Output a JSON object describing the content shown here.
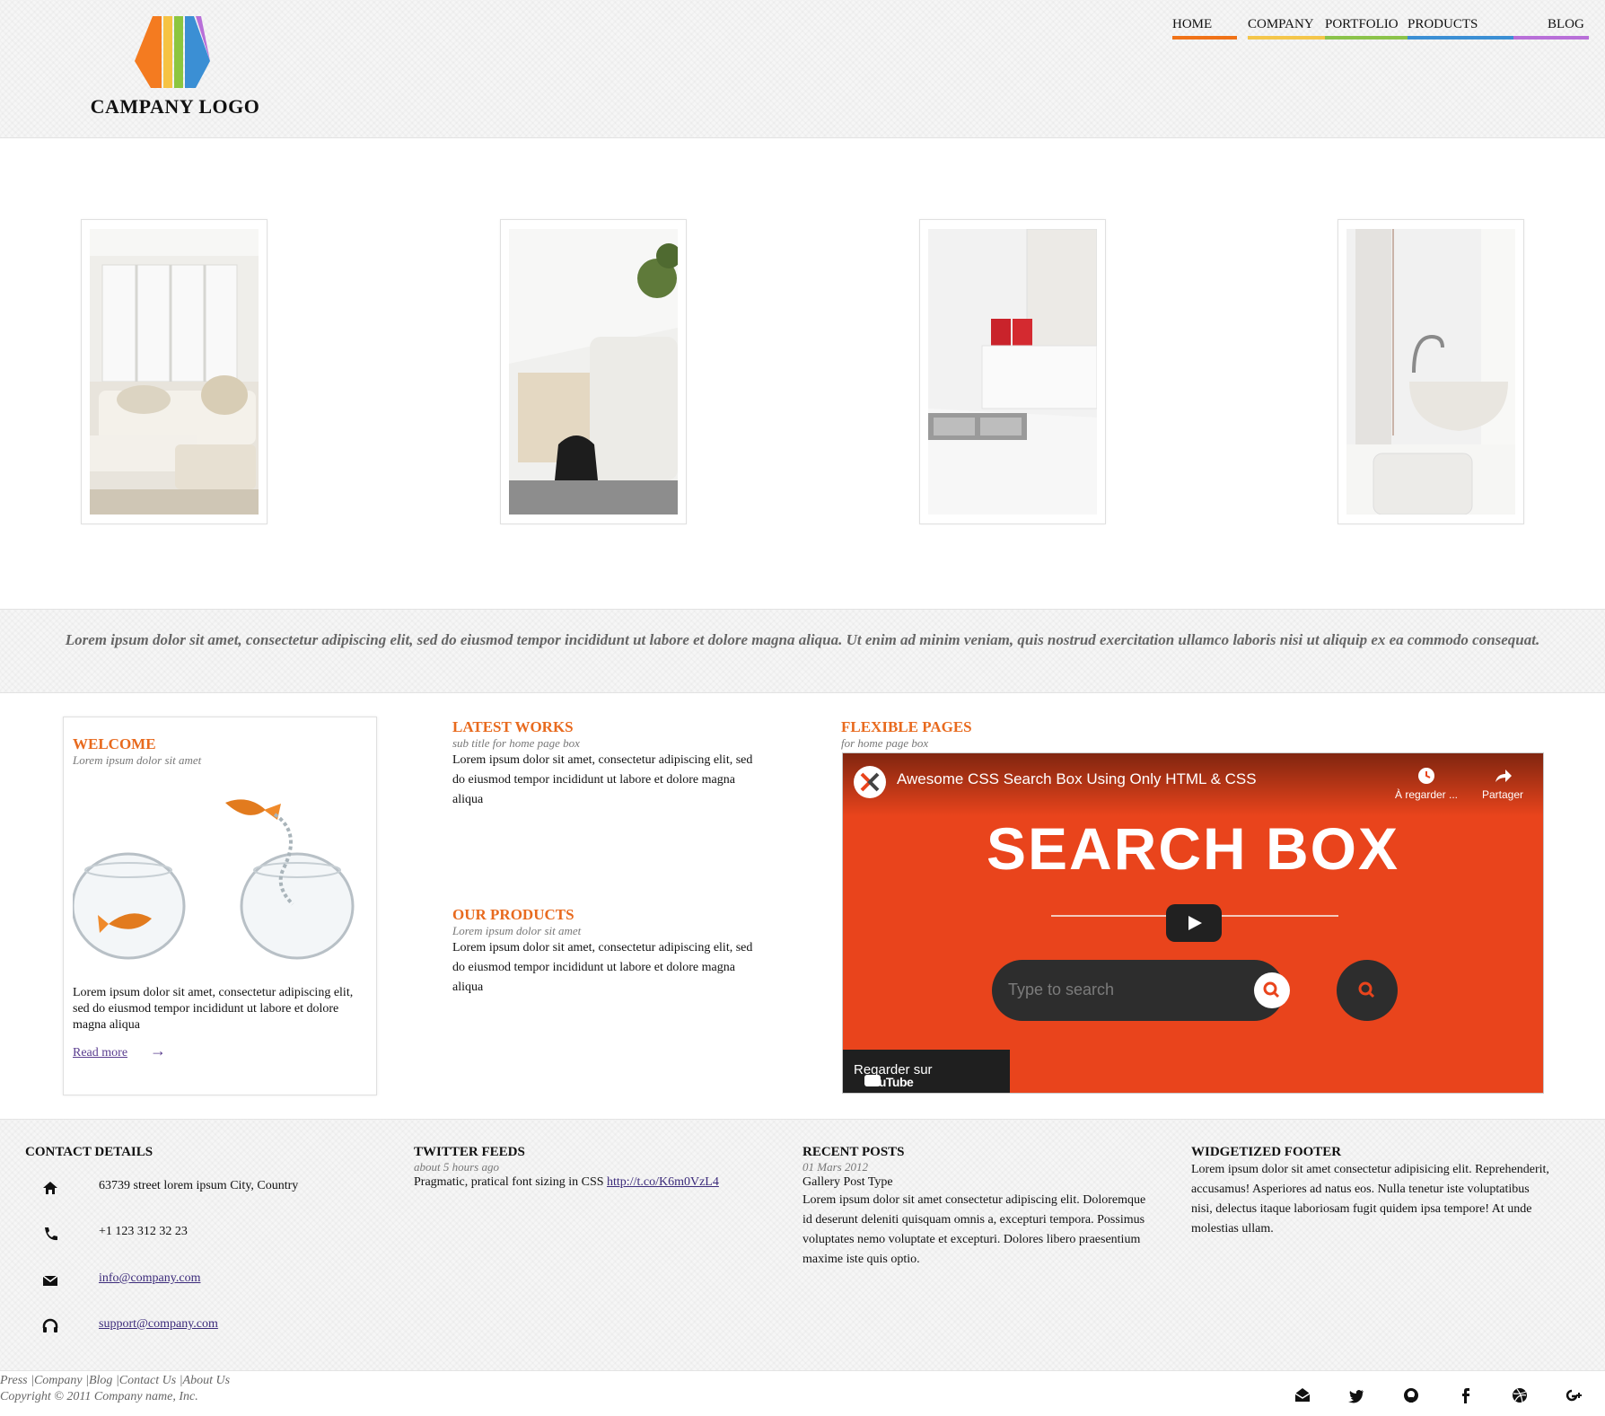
{
  "header": {
    "logo_text": "CAMPANY LOGO",
    "nav": [
      {
        "label": "HOME",
        "color": "#f07217"
      },
      {
        "label": "COMPANY",
        "color": "#f4c64a"
      },
      {
        "label": "PORTFOLIO",
        "color": "#8bc34a"
      },
      {
        "label": "PRODUCTS",
        "color": "#3b8fd4"
      },
      {
        "label": "BLOG",
        "color": "#b86fd8"
      }
    ]
  },
  "gallery": {
    "images": [
      {
        "alt": "living-room-image"
      },
      {
        "alt": "sofa-backpack-image"
      },
      {
        "alt": "kitchen-image"
      },
      {
        "alt": "bathroom-sink-image"
      }
    ]
  },
  "quote": "Lorem ipsum dolor sit amet, consectetur adipiscing elit, sed do eiusmod tempor incididunt ut labore et dolore magna aliqua. Ut enim ad minim veniam, quis nostrud exercitation ullamco laboris nisi ut aliquip ex ea commodo consequat.",
  "welcome": {
    "title": "WELCOME",
    "subtitle": "Lorem ipsum dolor sit amet",
    "text": "Lorem ipsum dolor sit amet, consectetur adipiscing elit, sed do eiusmod tempor incididunt ut labore et dolore magna aliqua",
    "read_more": "Read more"
  },
  "latest_works": {
    "title": "LATEST WORKS",
    "subtitle": "sub title for home page box",
    "text": "Lorem ipsum dolor sit amet, consectetur adipiscing elit, sed do eiusmod tempor incididunt ut labore et dolore magna aliqua"
  },
  "our_products": {
    "title": "OUR PRODUCTS",
    "subtitle": "Lorem ipsum dolor sit amet",
    "text": "Lorem ipsum dolor sit amet, consectetur adipiscing elit, sed do eiusmod tempor incididunt ut labore et dolore magna aliqua"
  },
  "flexible_pages": {
    "title": "FLEXIBLE PAGES",
    "subtitle": "for home page box",
    "video": {
      "title": "Awesome CSS Search Box Using Only HTML & CSS",
      "watch_later": "À regarder ...",
      "share": "Partager",
      "headline": "SEARCH BOX",
      "search_placeholder": "Type to search",
      "watch_on": "Regarder sur",
      "youtube": "YouTube",
      "bg_color": "#e9441c"
    }
  },
  "footer": {
    "contact": {
      "title": "CONTACT DETAILS",
      "address": "63739 street lorem ipsum City, Country",
      "phone": "+1 123 312 32 23",
      "email": "info@company.com",
      "support": "support@company.com"
    },
    "twitter": {
      "title": "TWITTER FEEDS",
      "time": "about 5 hours ago",
      "text": "Pragmatic, pratical font sizing in CSS",
      "link": "http://t.co/K6m0VzL4"
    },
    "recent": {
      "title": "RECENT POSTS",
      "date": "01 Mars 2012",
      "post_type": "Gallery Post Type",
      "text": "Lorem ipsum dolor sit amet consectetur adipiscing elit. Doloremque id deserunt deleniti quisquam omnis a, excepturi tempora. Possimus voluptates nemo voluptate et excepturi. Dolores libero praesentium maxime iste quis optio."
    },
    "widget": {
      "title": "WIDGETIZED FOOTER",
      "text": "Lorem ipsum dolor sit amet consectetur adipisicing elit. Reprehenderit, accusamus! Asperiores ad natus eos. Nulla tenetur iste voluptatibus nisi, delectus itaque laboriosam fugit quidem ipsa tempore! At unde molestias ullam."
    }
  },
  "bottom": {
    "links": [
      "Press",
      "Company",
      "Blog",
      "Contact Us",
      "About Us"
    ],
    "copyright": "Copyright © 2011 Company name, Inc.",
    "social": [
      "mail-icon",
      "twitter-icon",
      "github-icon",
      "facebook-icon",
      "dribbble-icon",
      "google-plus-icon"
    ]
  }
}
